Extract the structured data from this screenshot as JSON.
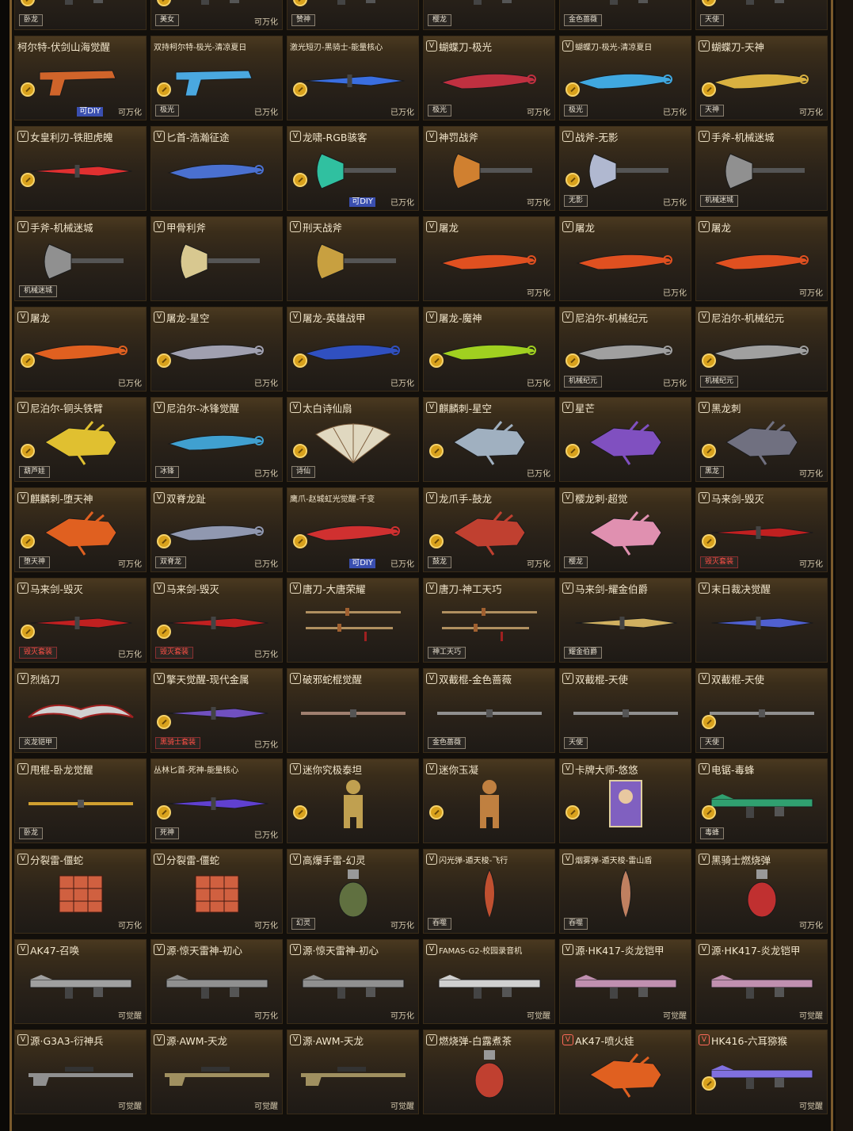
{
  "colors": {
    "accent_gold": "#d9a21d",
    "frame": "#7a5a2c",
    "diy_blue": "#3a4fb0",
    "tag_red": "#ff5046"
  },
  "cards": [
    {
      "title": "",
      "tag": "卧龙",
      "status": "",
      "coin": true,
      "color": "#c08a30",
      "shape": "rifle"
    },
    {
      "title": "",
      "tag": "美女",
      "status": "可万化",
      "coin": true,
      "color": "#888",
      "shape": "rifle"
    },
    {
      "title": "",
      "tag": "赞神",
      "status": "",
      "coin": true,
      "color": "#c8a040",
      "shape": "rifle"
    },
    {
      "title": "",
      "tag": "樱龙",
      "status": "",
      "coin": false,
      "color": "#c88090",
      "shape": "rifle"
    },
    {
      "title": "",
      "tag": "金色蔷薇",
      "status": "",
      "coin": false,
      "color": "#c09060",
      "shape": "rifle"
    },
    {
      "title": "",
      "tag": "天使",
      "status": "",
      "coin": true,
      "color": "#888",
      "shape": "rifle"
    },
    {
      "title": "柯尔特-伏剑山海觉醒",
      "tag": "",
      "status": "可万化",
      "diy": "可DIY",
      "coin": true,
      "color": "#d0642a",
      "shape": "pistol"
    },
    {
      "title": "双持柯尔特-极光-清凉夏日",
      "small": true,
      "tag": "极光",
      "status": "已万化",
      "coin": true,
      "color": "#4aa8e0",
      "shape": "pistol"
    },
    {
      "title": "激光短刃-黑骑士-能量核心",
      "small": true,
      "tag": "",
      "status": "已万化",
      "coin": true,
      "color": "#3a6ee0",
      "shape": "blade"
    },
    {
      "title": "蝴蝶刀-极光",
      "v": true,
      "tag": "极光",
      "status": "可万化",
      "coin": false,
      "color": "#c03040",
      "shape": "knife"
    },
    {
      "title": "蝴蝶刀-极光-清凉夏日",
      "v": true,
      "small": true,
      "tag": "极光",
      "status": "已万化",
      "coin": true,
      "color": "#40a8e0",
      "shape": "knife"
    },
    {
      "title": "蝴蝶刀-天神",
      "v": true,
      "tag": "天神",
      "status": "可万化",
      "coin": true,
      "color": "#d8b040",
      "shape": "knife"
    },
    {
      "title": "女皇利刃-铁胆虎魄",
      "v": true,
      "tag": "",
      "status": "",
      "coin": true,
      "color": "#e03030",
      "shape": "blade"
    },
    {
      "title": "匕首-浩瀚征途",
      "v": true,
      "tag": "",
      "status": "",
      "coin": false,
      "color": "#4a70d0",
      "shape": "knife"
    },
    {
      "title": "龙啸-RGB骇客",
      "v": true,
      "tag": "",
      "status": "已万化",
      "diy": "可DIY",
      "coin": true,
      "color": "#30c0a0",
      "shape": "axe"
    },
    {
      "title": "神罚战斧",
      "v": true,
      "tag": "",
      "status": "可万化",
      "coin": false,
      "color": "#d08030",
      "shape": "axe"
    },
    {
      "title": "战斧-无影",
      "v": true,
      "tag": "无影",
      "status": "已万化",
      "coin": true,
      "color": "#b0b8d0",
      "shape": "axe"
    },
    {
      "title": "手斧-机械迷城",
      "v": true,
      "tag": "机械迷城",
      "status": "",
      "coin": false,
      "color": "#909090",
      "shape": "axe"
    },
    {
      "title": "手斧-机械迷城",
      "v": true,
      "tag": "机械迷城",
      "status": "",
      "coin": false,
      "color": "#909090",
      "shape": "axe"
    },
    {
      "title": "甲骨利斧",
      "v": true,
      "tag": "",
      "status": "",
      "coin": false,
      "color": "#d8c890",
      "shape": "axe"
    },
    {
      "title": "刑天战斧",
      "v": true,
      "tag": "",
      "status": "",
      "coin": false,
      "color": "#c8a040",
      "shape": "axe"
    },
    {
      "title": "屠龙",
      "v": true,
      "tag": "",
      "status": "可万化",
      "coin": false,
      "color": "#e05020",
      "shape": "knife"
    },
    {
      "title": "屠龙",
      "v": true,
      "tag": "",
      "status": "已万化",
      "coin": false,
      "color": "#e05020",
      "shape": "knife"
    },
    {
      "title": "屠龙",
      "v": true,
      "tag": "",
      "status": "可万化",
      "coin": false,
      "color": "#e05020",
      "shape": "knife"
    },
    {
      "title": "屠龙",
      "v": true,
      "tag": "",
      "status": "已万化",
      "coin": true,
      "color": "#e06020",
      "shape": "knife"
    },
    {
      "title": "屠龙-星空",
      "v": true,
      "tag": "",
      "status": "已万化",
      "coin": true,
      "color": "#a0a0b0",
      "shape": "knife"
    },
    {
      "title": "屠龙-英雄战甲",
      "v": true,
      "tag": "",
      "status": "已万化",
      "coin": true,
      "color": "#3050c0",
      "shape": "knife"
    },
    {
      "title": "屠龙-魔神",
      "v": true,
      "tag": "",
      "status": "已万化",
      "coin": true,
      "color": "#a0d020",
      "shape": "knife"
    },
    {
      "title": "尼泊尔-机械纪元",
      "v": true,
      "tag": "机械纪元",
      "status": "已万化",
      "coin": true,
      "color": "#a0a0a0",
      "shape": "knife"
    },
    {
      "title": "尼泊尔-机械纪元",
      "v": true,
      "tag": "机械纪元",
      "status": "",
      "coin": true,
      "color": "#a0a0a0",
      "shape": "knife"
    },
    {
      "title": "尼泊尔-铜头铁臂",
      "v": true,
      "tag": "葫芦娃",
      "status": "",
      "coin": true,
      "color": "#e0c030",
      "shape": "fist"
    },
    {
      "title": "尼泊尔-冰锋觉醒",
      "v": true,
      "tag": "冰锋",
      "status": "已万化",
      "coin": false,
      "color": "#40a0d0",
      "shape": "knife"
    },
    {
      "title": "太白诗仙扇",
      "v": true,
      "tag": "诗仙",
      "status": "",
      "coin": true,
      "color": "#e0d8c0",
      "shape": "fan"
    },
    {
      "title": "麒麟刺-星空",
      "v": true,
      "tag": "",
      "status": "已万化",
      "coin": true,
      "color": "#a0b0c0",
      "shape": "fist"
    },
    {
      "title": "星芒",
      "v": true,
      "tag": "",
      "status": "",
      "coin": true,
      "color": "#8050c0",
      "shape": "fist"
    },
    {
      "title": "黑龙刺",
      "v": true,
      "tag": "黑龙",
      "status": "可万化",
      "coin": true,
      "color": "#707080",
      "shape": "fist"
    },
    {
      "title": "麒麟刺-堕天神",
      "v": true,
      "tag": "堕天神",
      "status": "可万化",
      "coin": true,
      "color": "#e06020",
      "shape": "fist"
    },
    {
      "title": "双脊龙趾",
      "v": true,
      "tag": "双脊龙",
      "status": "已万化",
      "coin": true,
      "color": "#9098b0",
      "shape": "knife"
    },
    {
      "title": "鹰爪-赵城虹光觉醒-千变",
      "small": true,
      "tag": "",
      "status": "已万化",
      "diy": "可DIY",
      "coin": true,
      "color": "#d03030",
      "shape": "knife"
    },
    {
      "title": "龙爪手-鼓龙",
      "v": true,
      "tag": "鼓龙",
      "status": "可万化",
      "coin": true,
      "color": "#c04030",
      "shape": "fist"
    },
    {
      "title": "樱龙刺·超觉",
      "v": true,
      "tag": "樱龙",
      "status": "",
      "coin": false,
      "color": "#e090b0",
      "shape": "fist"
    },
    {
      "title": "马来剑-毁灭",
      "v": true,
      "tag": "毁灭套装",
      "tagRed": true,
      "status": "可万化",
      "coin": true,
      "color": "#c02020",
      "shape": "blade"
    },
    {
      "title": "马来剑-毁灭",
      "v": true,
      "tag": "毁灭套装",
      "tagRed": true,
      "status": "已万化",
      "coin": true,
      "color": "#c02020",
      "shape": "blade"
    },
    {
      "title": "马来剑-毁灭",
      "v": true,
      "tag": "毁灭套装",
      "tagRed": true,
      "status": "已万化",
      "coin": true,
      "color": "#c02020",
      "shape": "blade"
    },
    {
      "title": "唐刀-大唐荣耀",
      "v": true,
      "tag": "",
      "status": "",
      "coin": false,
      "color": "#b09060",
      "shape": "sword"
    },
    {
      "title": "唐刀-神工天巧",
      "v": true,
      "tag": "神工天巧",
      "status": "",
      "coin": false,
      "color": "#b09060",
      "shape": "sword"
    },
    {
      "title": "马来剑-耀金伯爵",
      "v": true,
      "tag": "耀金伯爵",
      "status": "",
      "coin": false,
      "color": "#d0b060",
      "shape": "blade"
    },
    {
      "title": "末日裁决觉醒",
      "v": true,
      "tag": "",
      "status": "",
      "coin": false,
      "color": "#5060d0",
      "shape": "blade"
    },
    {
      "title": "烈焰刀",
      "v": true,
      "tag": "炎龙铠甲",
      "status": "",
      "coin": false,
      "color": "#d0d0d0",
      "shape": "wing"
    },
    {
      "title": "擎天觉醒-现代金属",
      "v": true,
      "tag": "黑骑士套装",
      "tagRed": true,
      "status": "已万化",
      "coin": true,
      "color": "#7050c0",
      "shape": "blade"
    },
    {
      "title": "破邪蛇棍觉醒",
      "v": true,
      "tag": "",
      "status": "",
      "coin": false,
      "color": "#a08070",
      "shape": "staff"
    },
    {
      "title": "双截棍-金色蔷薇",
      "v": true,
      "tag": "金色蔷薇",
      "status": "",
      "coin": false,
      "color": "#909090",
      "shape": "staff"
    },
    {
      "title": "双截棍-天使",
      "v": true,
      "tag": "天使",
      "status": "",
      "coin": false,
      "color": "#909090",
      "shape": "staff"
    },
    {
      "title": "双截棍-天使",
      "v": true,
      "tag": "天使",
      "status": "",
      "coin": true,
      "color": "#909090",
      "shape": "staff"
    },
    {
      "title": "甩棍-卧龙觉醒",
      "v": true,
      "tag": "卧龙",
      "status": "",
      "coin": false,
      "color": "#d0a030",
      "shape": "staff"
    },
    {
      "title": "丛林匕首-死神-能量核心",
      "small": true,
      "tag": "死神",
      "status": "已万化",
      "coin": true,
      "color": "#6040d0",
      "shape": "blade"
    },
    {
      "title": "迷你究极泰坦",
      "v": true,
      "tag": "",
      "status": "",
      "coin": true,
      "color": "#c0a050",
      "shape": "figure"
    },
    {
      "title": "迷你玉凝",
      "v": true,
      "tag": "",
      "status": "",
      "coin": true,
      "color": "#c08040",
      "shape": "figure"
    },
    {
      "title": "卡牌大师-悠悠",
      "v": true,
      "tag": "",
      "status": "",
      "coin": true,
      "color": "#8060c0",
      "shape": "card"
    },
    {
      "title": "电锯-毒蜂",
      "v": true,
      "tag": "毒蜂",
      "status": "",
      "coin": true,
      "color": "#30a070",
      "shape": "rifle"
    },
    {
      "title": "分裂雷-僵蛇",
      "v": true,
      "tag": "",
      "status": "可万化",
      "coin": false,
      "color": "#d06040",
      "shape": "cube"
    },
    {
      "title": "分裂雷-僵蛇",
      "v": true,
      "tag": "",
      "status": "可万化",
      "coin": false,
      "color": "#d06040",
      "shape": "cube"
    },
    {
      "title": "高爆手雷-幻灵",
      "v": true,
      "tag": "幻灵",
      "status": "可万化",
      "coin": false,
      "color": "#607040",
      "shape": "grenade"
    },
    {
      "title": "闪光弹-遁天梭-飞行",
      "v": true,
      "small": true,
      "tag": "吞噬",
      "status": "",
      "coin": false,
      "color": "#c05030",
      "shape": "shuttle"
    },
    {
      "title": "烟雾弹-遁天梭-雷山盾",
      "v": true,
      "small": true,
      "tag": "吞噬",
      "status": "",
      "coin": false,
      "color": "#c08060",
      "shape": "shuttle"
    },
    {
      "title": "黑骑士燃烧弹",
      "v": true,
      "tag": "",
      "status": "可万化",
      "coin": false,
      "color": "#c03030",
      "shape": "grenade"
    },
    {
      "title": "AK47-召唤",
      "v": true,
      "tag": "",
      "status": "可觉醒",
      "coin": false,
      "color": "#a0a0a0",
      "shape": "rifle"
    },
    {
      "title": "源·惊天雷神-初心",
      "v": true,
      "tag": "",
      "status": "可万化",
      "coin": false,
      "color": "#909090",
      "shape": "rifle"
    },
    {
      "title": "源·惊天雷神-初心",
      "v": true,
      "tag": "",
      "status": "可万化",
      "coin": false,
      "color": "#909090",
      "shape": "rifle"
    },
    {
      "title": "FAMAS-G2-校园录音机",
      "v": true,
      "small": true,
      "tag": "",
      "status": "可觉醒",
      "coin": false,
      "color": "#d0d0d0",
      "shape": "rifle"
    },
    {
      "title": "源·HK417-炎龙铠甲",
      "v": true,
      "tag": "",
      "status": "可觉醒",
      "coin": false,
      "color": "#c090b0",
      "shape": "rifle"
    },
    {
      "title": "源·HK417-炎龙铠甲",
      "v": true,
      "tag": "",
      "status": "可觉醒",
      "coin": false,
      "color": "#c090b0",
      "shape": "rifle"
    },
    {
      "title": "源·G3A3-衍神兵",
      "v": true,
      "tag": "",
      "status": "可觉醒",
      "coin": false,
      "color": "#909090",
      "shape": "sniper"
    },
    {
      "title": "源·AWM-天龙",
      "v": true,
      "tag": "",
      "status": "可觉醒",
      "coin": false,
      "color": "#a09060",
      "shape": "sniper"
    },
    {
      "title": "源·AWM-天龙",
      "v": true,
      "tag": "",
      "status": "可觉醒",
      "coin": false,
      "color": "#a09060",
      "shape": "sniper"
    },
    {
      "title": "燃烧弹-白露煮茶",
      "v": true,
      "tag": "",
      "status": "",
      "coin": false,
      "color": "#c04030",
      "shape": "grenade"
    },
    {
      "title": "AK47-喷火娃",
      "v": true,
      "vRed": true,
      "tag": "",
      "status": "",
      "coin": false,
      "color": "#e06020",
      "shape": "fist"
    },
    {
      "title": "HK416-六耳猕猴",
      "v": true,
      "vRed": true,
      "tag": "",
      "status": "可觉醒",
      "coin": true,
      "color": "#8070e0",
      "shape": "rifle"
    }
  ]
}
